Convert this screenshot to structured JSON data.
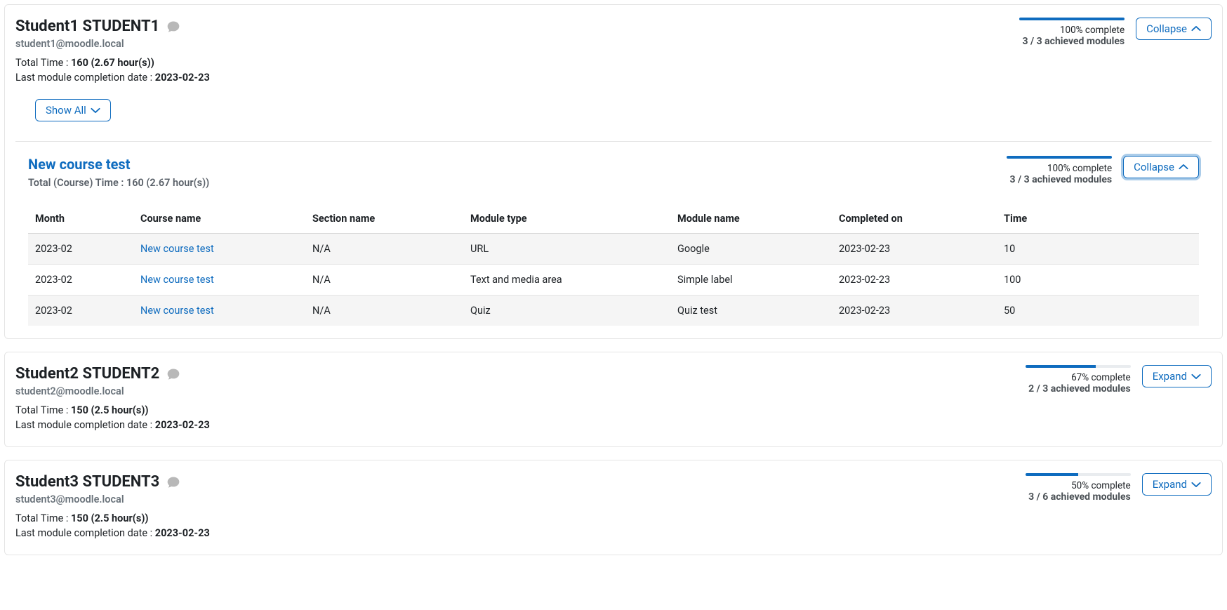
{
  "labels": {
    "total_time_prefix": "Total Time : ",
    "last_completion_prefix": "Last module completion date : ",
    "show_all": "Show All",
    "collapse": "Collapse",
    "expand": "Expand",
    "complete_suffix": "complete",
    "achieved_suffix": "achieved modules",
    "course_total_prefix": "Total (Course) Time : "
  },
  "table_headers": {
    "month": "Month",
    "course_name": "Course name",
    "section_name": "Section name",
    "module_type": "Module type",
    "module_name": "Module name",
    "completed_on": "Completed on",
    "time": "Time"
  },
  "students": [
    {
      "name": "Student1 STUDENT1",
      "email": "student1@moodle.local",
      "total_time": "160 (2.67 hour(s))",
      "last_completion": "2023-02-23",
      "progress_pct": "100%",
      "progress_fill": 100,
      "achieved": "3 / 3",
      "toggle": "collapse",
      "expanded": true,
      "course": {
        "title": "New course test",
        "total_time": "160 (2.67 hour(s))",
        "progress_pct": "100%",
        "progress_fill": 100,
        "achieved": "3 / 3",
        "toggle": "collapse",
        "toggle_focused": true,
        "rows": [
          {
            "month": "2023-02",
            "course": "New course test",
            "section": "N/A",
            "type": "URL",
            "name": "Google",
            "completed": "2023-02-23",
            "time": "10"
          },
          {
            "month": "2023-02",
            "course": "New course test",
            "section": "N/A",
            "type": "Text and media area",
            "name": "Simple label",
            "completed": "2023-02-23",
            "time": "100"
          },
          {
            "month": "2023-02",
            "course": "New course test",
            "section": "N/A",
            "type": "Quiz",
            "name": "Quiz test",
            "completed": "2023-02-23",
            "time": "50"
          }
        ]
      }
    },
    {
      "name": "Student2 STUDENT2",
      "email": "student2@moodle.local",
      "total_time": "150 (2.5 hour(s))",
      "last_completion": "2023-02-23",
      "progress_pct": "67%",
      "progress_fill": 67,
      "achieved": "2 / 3",
      "toggle": "expand",
      "expanded": false
    },
    {
      "name": "Student3 STUDENT3",
      "email": "student3@moodle.local",
      "total_time": "150 (2.5 hour(s))",
      "last_completion": "2023-02-23",
      "progress_pct": "50%",
      "progress_fill": 50,
      "achieved": "3 / 6",
      "toggle": "expand",
      "expanded": false
    }
  ]
}
